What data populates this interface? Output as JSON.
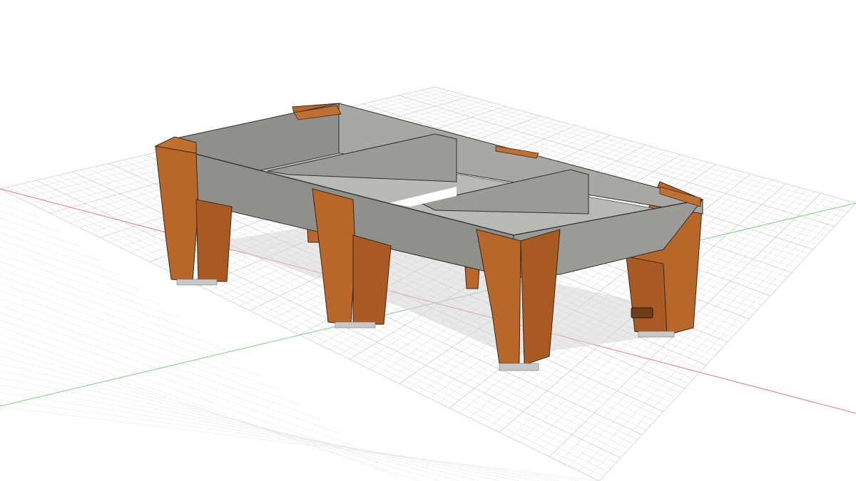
{
  "viewport": {
    "label": "",
    "colors": {
      "background": "#ffffff",
      "grid_minor": "#e4e4e4",
      "grid_major": "#c8c8c8",
      "axis_x": "#e08080",
      "axis_y": "#80d080",
      "frame_face": "#8f908b",
      "frame_face_light": "#a7a8a3",
      "frame_inner": "#b9bab5",
      "leg_wood": "#b8662a",
      "leg_wood_dark": "#8e4a1a",
      "leg_edge": "#3a2a1a",
      "foot_pad": "#c8c8c8"
    }
  },
  "model": {
    "legs": [
      "leg-front-left",
      "leg-front-middle",
      "leg-front-right",
      "leg-back-right",
      "leg-back-left",
      "leg-back-middle"
    ],
    "cross_members": 2
  }
}
